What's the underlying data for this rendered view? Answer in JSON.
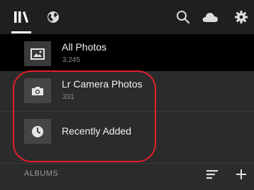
{
  "toolbar": {
    "icons": [
      "library-icon",
      "globe-icon",
      "search-icon",
      "cloud-icon",
      "gear-icon"
    ]
  },
  "rows": [
    {
      "title": "All Photos",
      "count": "3,245",
      "icon": "image-icon"
    },
    {
      "title": "Lr Camera Photos",
      "count": "331",
      "icon": "camera-icon"
    },
    {
      "title": "Recently Added",
      "icon": "clock-icon"
    }
  ],
  "albums": {
    "label": "ALBUMS",
    "icons": [
      "sort-icon",
      "add-icon"
    ]
  },
  "colors": {
    "highlight": "#e0202a",
    "selected_row": "#000000",
    "background": "#2b2b2b"
  }
}
